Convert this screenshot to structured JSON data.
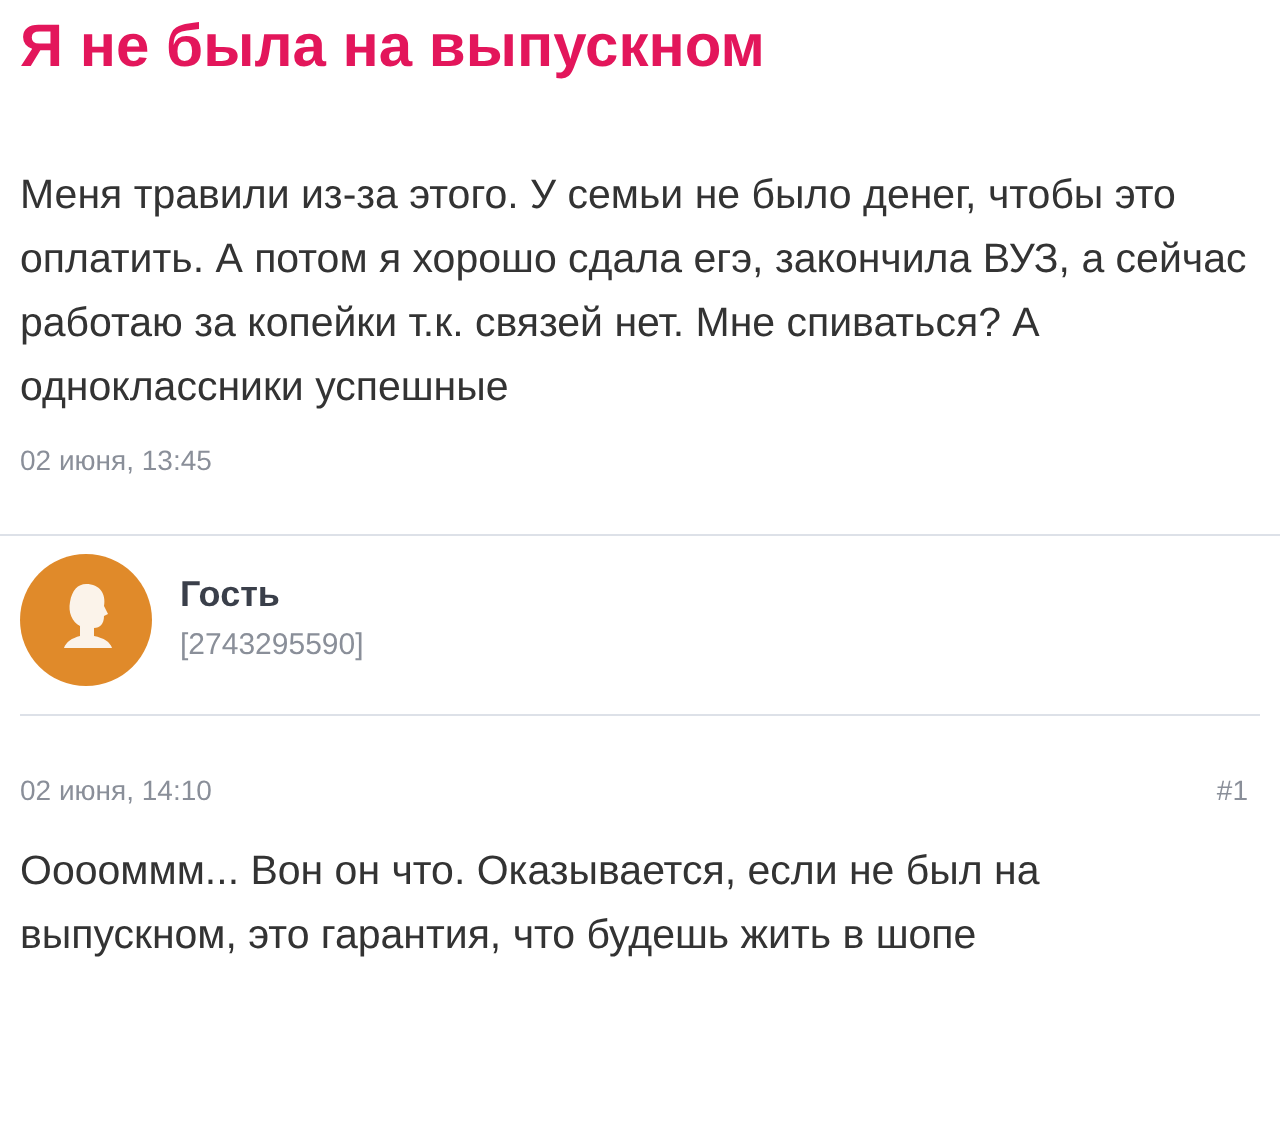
{
  "title": "Я не была на выпускном",
  "post": {
    "text": "Меня травили из-за этого. У семьи не было денег, чтобы это оплатить. А потом я хорошо сдала егэ, закончила ВУЗ, а сейчас работаю за копейки т.к. связей нет. Мне спиваться? А одноклассники успешные",
    "date": "02 июня, 13:45"
  },
  "comment": {
    "author": "Гость",
    "user_id": "[2743295590]",
    "date": "02 июня, 14:10",
    "number": "#1",
    "text": "Ооооммм... Вон он что. Оказывается, если не был на выпускном, это гарантия, что будешь жить в шопе"
  }
}
